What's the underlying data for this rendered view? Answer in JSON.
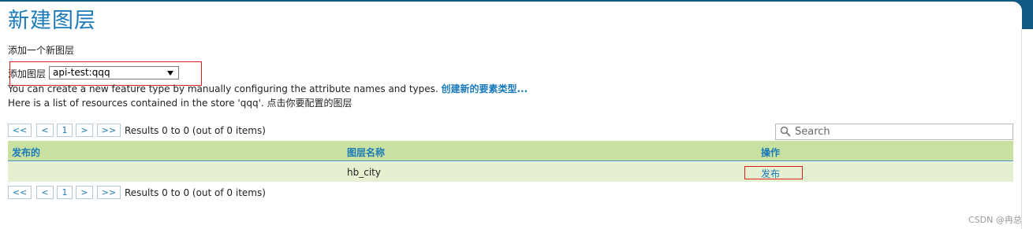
{
  "page": {
    "title": "新建图层",
    "subtitle": "添加一个新图层"
  },
  "add_layer": {
    "label": "添加图层",
    "selected_store": "api-test:qqq"
  },
  "info": {
    "text1_prefix": "You can create a new feature type by manually configuring the attribute names and types.",
    "create_link": "创建新的要素类型...",
    "text2": "Here is a list of resources contained in the store 'qqq'. 点击你要配置的图层"
  },
  "pager": {
    "first": "<<",
    "prev": "<",
    "page": "1",
    "next": ">",
    "last": ">>",
    "results": "Results 0 to 0 (out of 0 items)"
  },
  "search": {
    "placeholder": "Search"
  },
  "table": {
    "headers": [
      "发布的",
      "图层名称",
      "操作"
    ],
    "rows": [
      {
        "published": "",
        "layer_name": "hb_city",
        "action": "发布"
      }
    ]
  },
  "watermark": "CSDN @冉总",
  "colors": {
    "accent": "#1a7aba",
    "header_bg": "#c8e0a0",
    "row_bg": "#e4f0cf",
    "frame": "#0f5a82",
    "highlight_box": "#e02020"
  }
}
